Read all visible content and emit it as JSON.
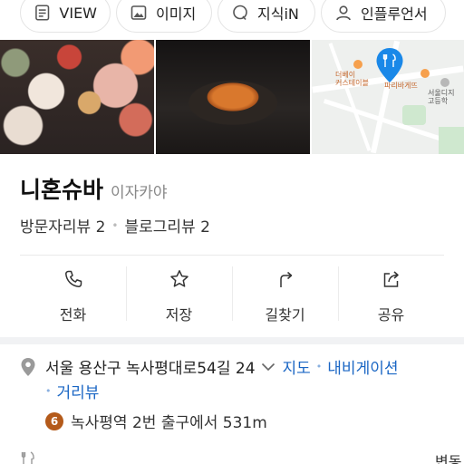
{
  "chips": {
    "view": "VIEW",
    "image": "이미지",
    "kin": "지식iN",
    "influencer": "인플루언서"
  },
  "map": {
    "label_starbucks": "더베이\n커스테이블",
    "label_paris": "파리바게뜨",
    "label_school": "서울디지\n고등학",
    "accent": "#1a88e8"
  },
  "place": {
    "name": "니혼슈바",
    "category": "이자카야",
    "visitor_review": "방문자리뷰 2",
    "blog_review": "블로그리뷰 2"
  },
  "actions": [
    {
      "label": "전화",
      "icon": "phone-icon"
    },
    {
      "label": "저장",
      "icon": "star-icon"
    },
    {
      "label": "길찾기",
      "icon": "directions-icon"
    },
    {
      "label": "공유",
      "icon": "share-icon"
    }
  ],
  "address": {
    "text": "서울 용산구 녹사평대로54길 24",
    "map_link": "지도",
    "navigation_link": "내비게이션",
    "street_view_link": "거리뷰"
  },
  "station": {
    "line_number": "6",
    "text": "녹사평역 2번 출구에서 531m",
    "line_color": "#b45a1a"
  },
  "hours": {
    "status": "변동"
  },
  "colors": {
    "link": "#1a66c4",
    "divider": "#e9e9e9"
  }
}
